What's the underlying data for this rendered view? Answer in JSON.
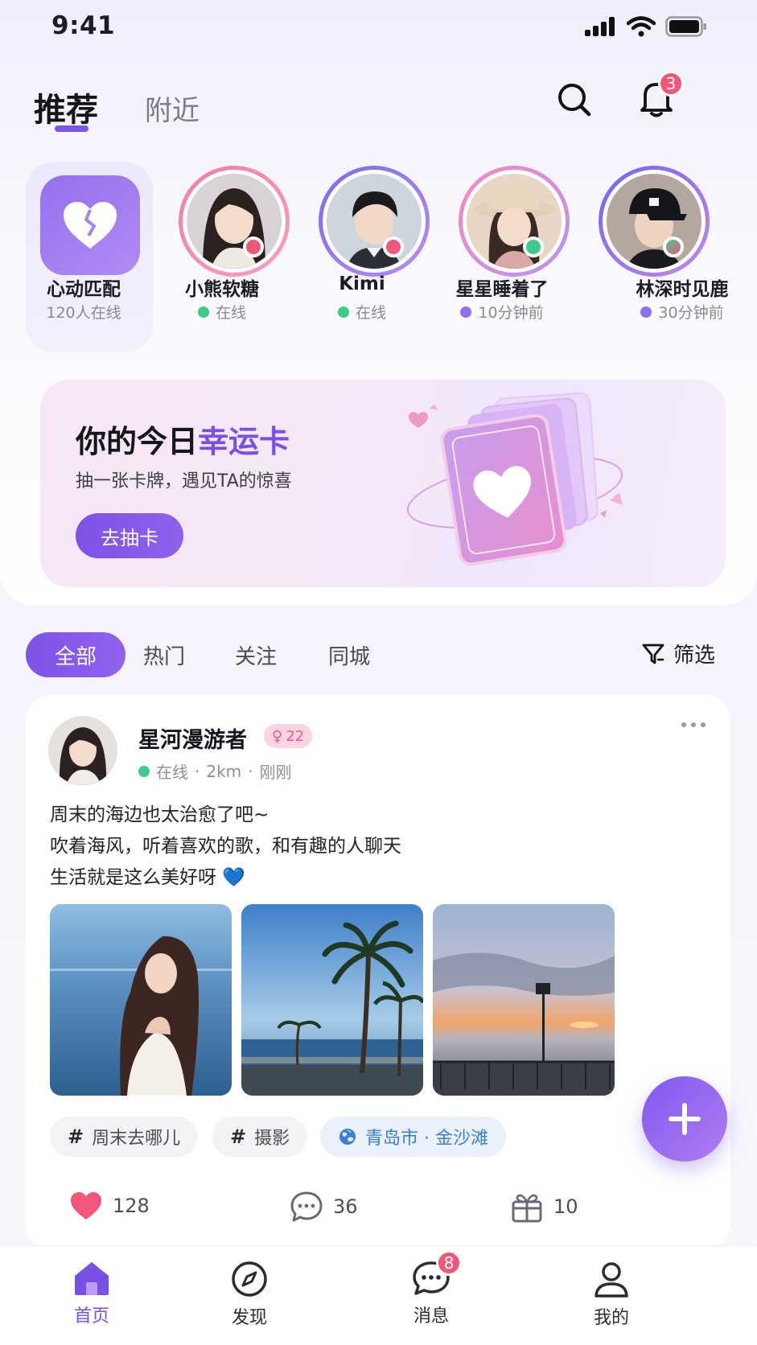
{
  "status_bar": {
    "time": "9:41"
  },
  "header": {
    "tabs": [
      {
        "label": "推荐",
        "active": true
      },
      {
        "label": "附近",
        "active": false
      }
    ],
    "notification_count": "3"
  },
  "stories": {
    "match": {
      "label": "心动匹配",
      "sub": "120人在线"
    },
    "users": [
      {
        "name": "小熊软糖",
        "status": "在线",
        "status_color": "#3fc98b",
        "ring": "pink"
      },
      {
        "name": "Kimi",
        "status": "在线",
        "status_color": "#3fc98b",
        "ring": "purple"
      },
      {
        "name": "星星睡着了",
        "status": "10分钟前",
        "status_color": "#8f6ff0",
        "ring": "pink"
      },
      {
        "name": "林深时见鹿",
        "status": "30分钟前",
        "status_color": "#8f6ff0",
        "ring": "purple"
      }
    ]
  },
  "lucky_card": {
    "title_prefix": "你的今日",
    "title_highlight": "幸运卡",
    "description": "抽一张卡牌，遇见TA的惊喜",
    "button": "去抽卡"
  },
  "feed_tabs": {
    "items": [
      "全部",
      "热门",
      "关注",
      "同城"
    ],
    "active_index": 0,
    "filter_label": "筛选"
  },
  "post": {
    "author": "星河漫游者",
    "gender_symbol": "♀",
    "age": "22",
    "online": "在线",
    "distance": "2km",
    "time": "刚刚",
    "text_lines": [
      "周末的海边也太治愈了吧~",
      "吹着海风，听着喜欢的歌，和有趣的人聊天",
      "生活就是这么美好呀 💙"
    ],
    "tags": [
      "周末去哪儿",
      "摄影"
    ],
    "location": "青岛市 · 金沙滩",
    "likes": "128",
    "comments": "36",
    "gifts": "10"
  },
  "bottom_nav": {
    "items": [
      {
        "label": "首页",
        "active": true
      },
      {
        "label": "发现",
        "active": false
      },
      {
        "label": "消息",
        "active": false,
        "badge": "8"
      },
      {
        "label": "我的",
        "active": false
      }
    ]
  },
  "colors": {
    "accent": "#7a4fe6",
    "like": "#f2577a",
    "online": "#3fc98b"
  }
}
